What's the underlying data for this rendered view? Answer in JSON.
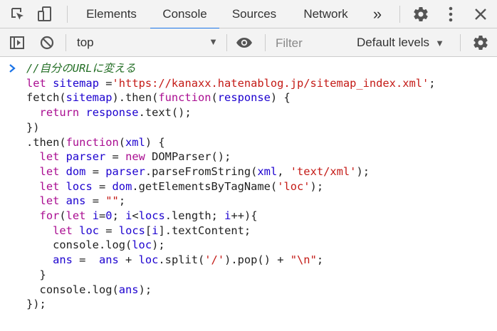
{
  "devtools": {
    "tabs": [
      {
        "label": "Elements"
      },
      {
        "label": "Console",
        "active": true
      },
      {
        "label": "Sources"
      },
      {
        "label": "Network"
      }
    ],
    "more_tabs_glyph": "»",
    "accent_color": "#1a73e8",
    "icons": [
      "inspect-element-icon",
      "device-toolbar-icon",
      "more-tabs-icon",
      "settings-gear-icon",
      "kebab-menu-icon",
      "close-icon"
    ]
  },
  "console_toolbar": {
    "context": "top",
    "filter_placeholder": "Filter",
    "levels_label": "Default levels",
    "icons": [
      "sidebar-toggle-icon",
      "clear-console-icon",
      "eye-icon",
      "settings-gear-icon"
    ]
  },
  "console": {
    "prompt_glyph": "›",
    "code": {
      "comment": "//自分のURLに変える",
      "line2_kw": "let",
      "line2_var": "sitemap",
      "line2_op": " =",
      "line2_str": "'https://kanaxx.hatenablog.jp/sitemap_index.xml'",
      "line2_end": ";",
      "line3_a": "fetch(",
      "line3_var": "sitemap",
      "line3_b": ").then(",
      "line3_kw": "function",
      "line3_c": "(",
      "line3_var2": "response",
      "line3_d": ") {",
      "line4_kw": "return",
      "line4_var": "response",
      "line4_rest": ".text();",
      "line5": "})",
      "line6_a": ".then(",
      "line6_kw": "function",
      "line6_b": "(",
      "line6_var": "xml",
      "line6_c": ") {",
      "line7_kw": "let",
      "line7_var": "parser",
      "line7_op": " = ",
      "line7_kw2": "new",
      "line7_rest": " DOMParser();",
      "line8_kw": "let",
      "line8_var": "dom",
      "line8_op": " = ",
      "line8_var2": "parser",
      "line8_a": ".parseFromString(",
      "line8_var3": "xml",
      "line8_b": ", ",
      "line8_str": "'text/xml'",
      "line8_c": ");",
      "line9_kw": "let",
      "line9_var": "locs",
      "line9_op": " = ",
      "line9_var2": "dom",
      "line9_a": ".getElementsByTagName(",
      "line9_str": "'loc'",
      "line9_b": ");",
      "line10_kw": "let",
      "line10_var": "ans",
      "line10_op": " = ",
      "line10_str": "\"\"",
      "line10_end": ";",
      "line11_kw": "for",
      "line11_a": "(",
      "line11_kw2": "let",
      "line11_var": "i",
      "line11_b": "=",
      "line11_num": "0",
      "line11_c": "; ",
      "line11_var2": "i",
      "line11_d": "<",
      "line11_var3": "locs",
      "line11_e": ".length; ",
      "line11_var4": "i",
      "line11_f": "++){",
      "line12_kw": "let",
      "line12_var": "loc",
      "line12_op": " = ",
      "line12_var2": "locs",
      "line12_a": "[",
      "line12_var3": "i",
      "line12_b": "].textContent;",
      "line13_a": "console.log(",
      "line13_var": "loc",
      "line13_b": ");",
      "line14_var": "ans",
      "line14_a": " =  ",
      "line14_var2": "ans",
      "line14_b": " + ",
      "line14_var3": "loc",
      "line14_c": ".split(",
      "line14_str": "'/'",
      "line14_d": ").pop() + ",
      "line14_str2": "\"\\n\"",
      "line14_e": ";",
      "line15": "}",
      "line16_a": "console.log(",
      "line16_var": "ans",
      "line16_b": ");",
      "line17": "});"
    }
  }
}
